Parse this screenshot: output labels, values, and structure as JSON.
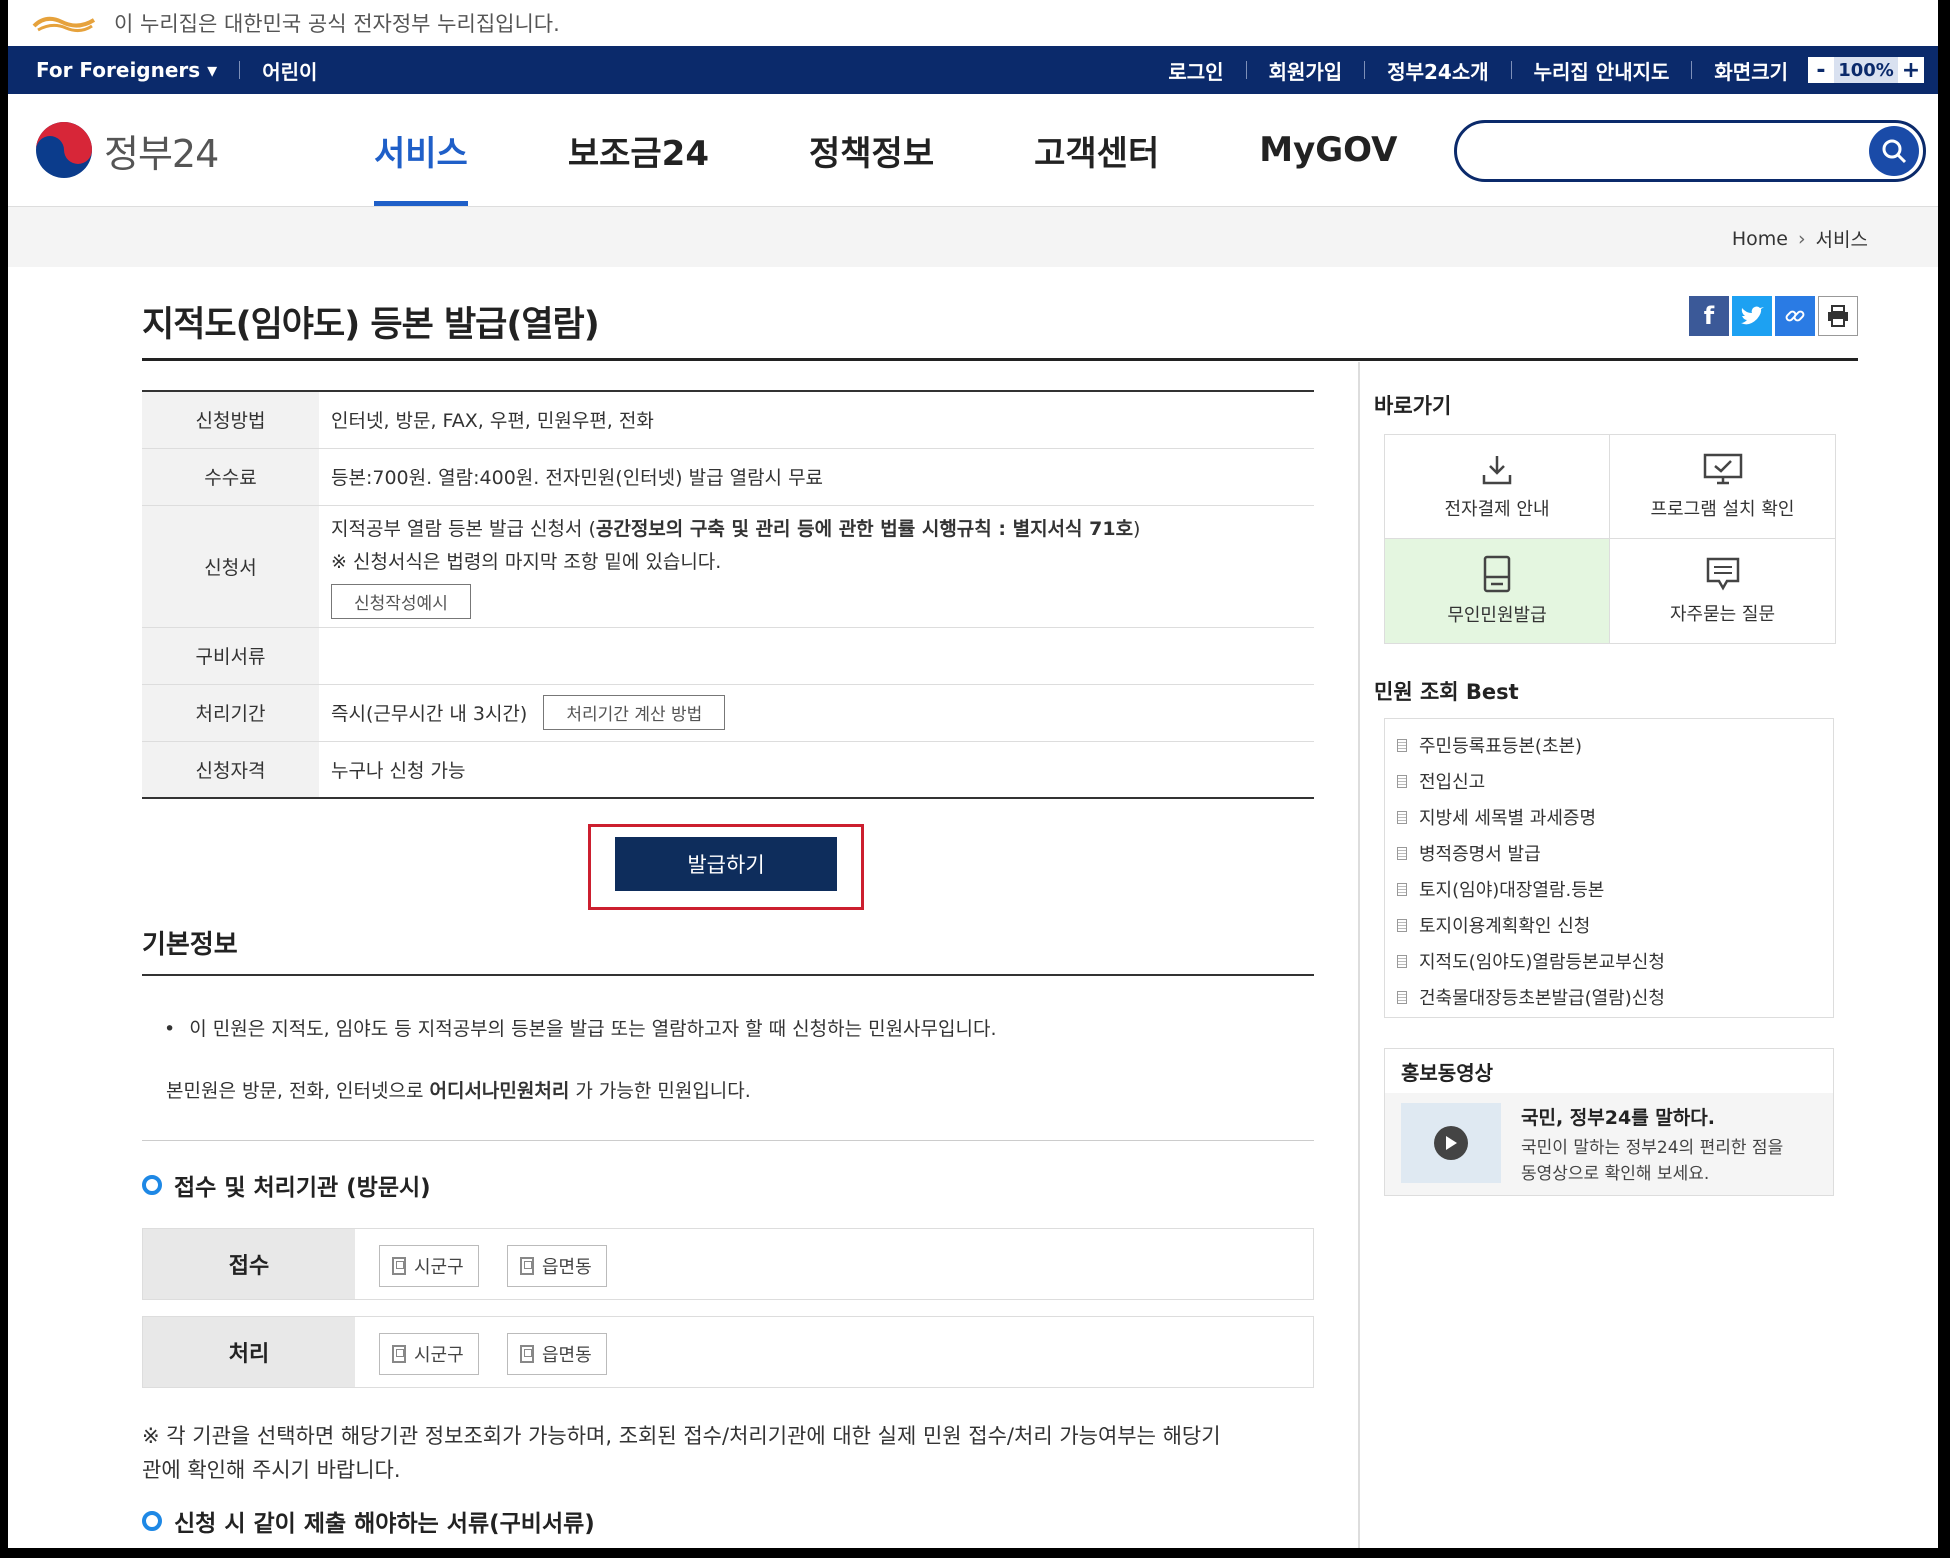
{
  "notice": {
    "text": "이 누리집은 대한민국 공식 전자정부 누리집입니다."
  },
  "util": {
    "foreigners": "For Foreigners",
    "kids": "어린이",
    "login": "로그인",
    "signup": "회원가입",
    "about": "정부24소개",
    "sitemap": "누리집 안내지도",
    "screen_size": "화면크기",
    "zoom_minus": "-",
    "zoom_value": "100%",
    "zoom_plus": "+"
  },
  "header": {
    "brand": "정부24",
    "nav": [
      "서비스",
      "보조금24",
      "정책정보",
      "고객센터",
      "MyGOV"
    ],
    "active_nav": "서비스",
    "search_placeholder": ""
  },
  "breadcrumb": {
    "home": "Home",
    "current": "서비스"
  },
  "page": {
    "title": "지적도(임야도) 등본 발급(열람)"
  },
  "info": {
    "method_label": "신청방법",
    "method_value": "인터넷, 방문, FAX, 우편, 민원우편, 전화",
    "fee_label": "수수료",
    "fee_value": "등본:700원. 열람:400원. 전자민원(인터넷) 발급 열람시 무료",
    "form_label": "신청서",
    "form_value_prefix": "지적공부 열람 등본 발급 신청서 (",
    "form_value_bold": "공간정보의 구축 및 관리 등에 관한 법률 시행규칙 : 별지서식 71호",
    "form_value_suffix": ")",
    "form_note": "※ 신청서식은 법령의 마지막 조항 밑에 있습니다.",
    "form_example_button": "신청작성예시",
    "docs_label": "구비서류",
    "docs_value": "",
    "period_label": "처리기간",
    "period_value": "즉시(근무시간 내 3시간)",
    "period_button": "처리기간 계산 방법",
    "qual_label": "신청자격",
    "qual_value": "누구나 신청 가능"
  },
  "issue_button": "발급하기",
  "basic": {
    "heading": "기본정보",
    "bullet": "이 민원은 지적도, 임야도 등 지적공부의 등본을 발급 또는 열람하고자 할 때 신청하는 민원사무입니다.",
    "line_prefix": "본민원은 방문, 전화, 인터넷으로 ",
    "line_bold": "어디서나민원처리",
    "line_suffix": " 가 가능한 민원입니다."
  },
  "orgs": {
    "heading": "접수 및 처리기관 (방문시)",
    "receive_label": "접수",
    "process_label": "처리",
    "chip1": "시군구",
    "chip2": "읍면동",
    "note_line1": "※ 각 기관을 선택하면 해당기관 정보조회가 가능하며, 조회된 접수/처리기관에 대한 실제 민원 접수/처리 가능여부는 해당기",
    "note_line2": "관에 확인해 주시기 바랍니다."
  },
  "required_docs_heading": "신청 시 같이 제출 해야하는 서류(구비서류)",
  "sidebar": {
    "shortcuts_title": "바로가기",
    "shortcuts": [
      "전자결제 안내",
      "프로그램 설치 확인",
      "무인민원발급",
      "자주묻는 질문"
    ],
    "best_title": "민원 조회 Best",
    "best": [
      "주민등록표등본(초본)",
      "전입신고",
      "지방세 세목별 과세증명",
      "병적증명서 발급",
      "토지(임야)대장열람.등본",
      "토지이용계획확인 신청",
      "지적도(임야도)열람등본교부신청",
      "건축물대장등초본발급(열람)신청"
    ],
    "promo_title": "홍보동영상",
    "promo_headline": "국민, 정부24를 말하다.",
    "promo_desc1": "국민이 말하는 정부24의 편리한 점을",
    "promo_desc2": "동영상으로 확인해 보세요."
  },
  "colors": {
    "accent": "#1f5fc8",
    "nav_bar": "#0b2a6b",
    "issue_button": "#0e2d5c",
    "highlight_border": "#cc1f2f"
  }
}
